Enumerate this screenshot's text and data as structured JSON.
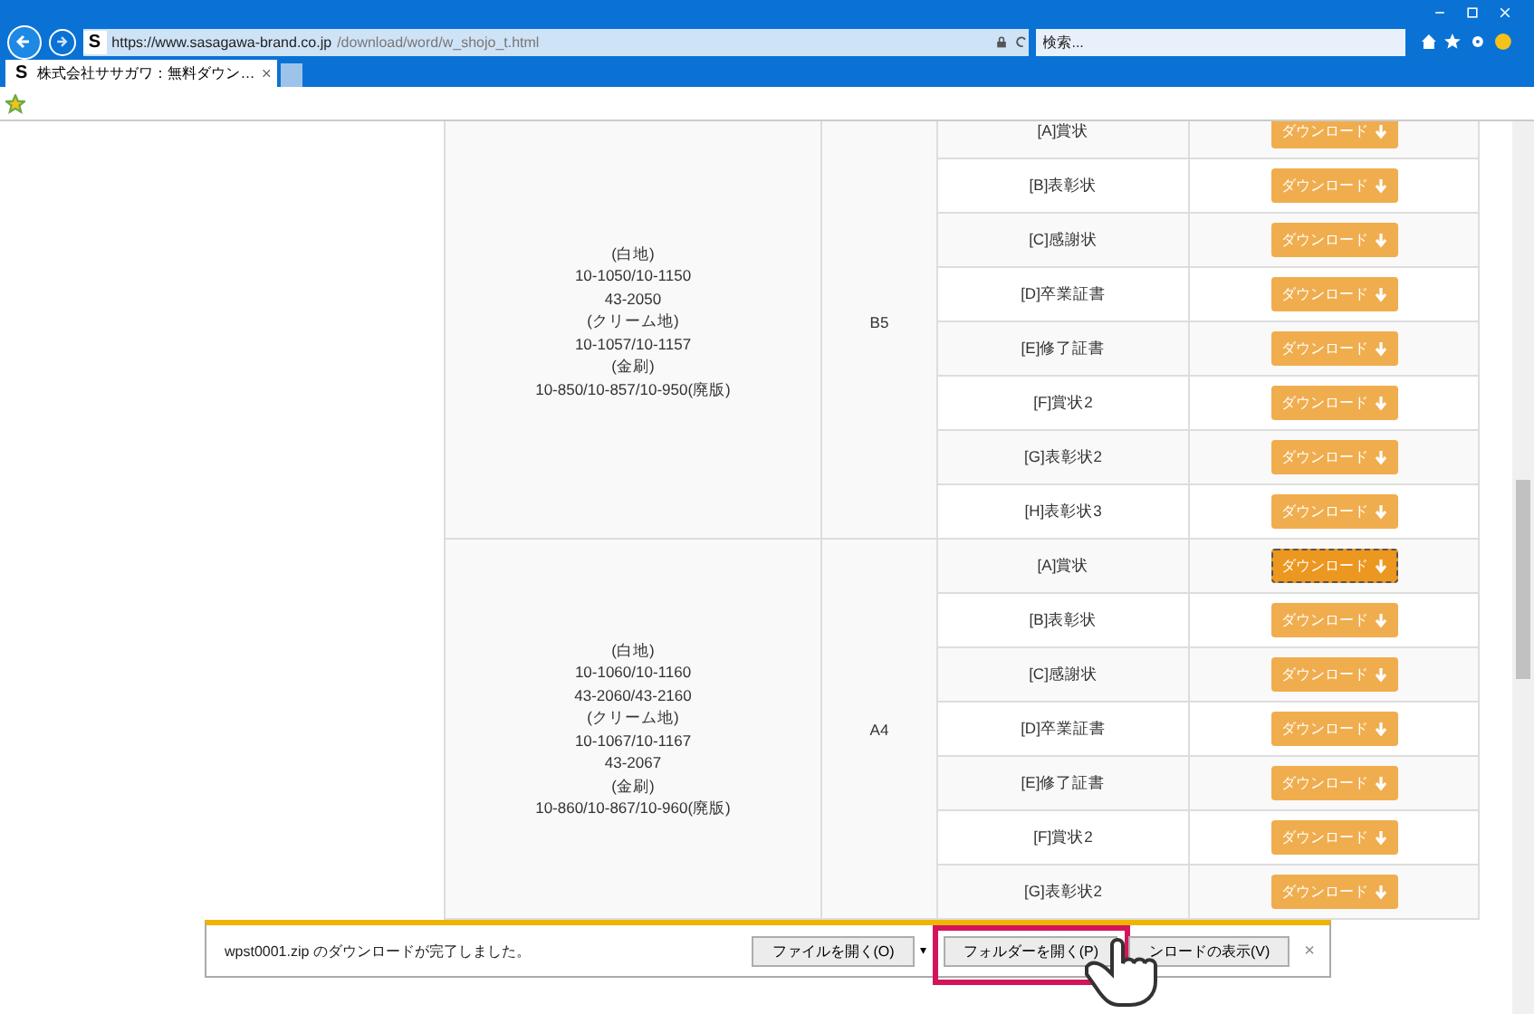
{
  "browser": {
    "address": {
      "site_icon": "S",
      "host": "https://www.sasagawa-brand.co.jp",
      "path": "/download/word/w_shojo_t.html"
    },
    "search": {
      "placeholder": "検索..."
    },
    "tabs": [
      {
        "icon": "S",
        "title": "株式会社ササガワ：無料ダウン…",
        "selected": true
      }
    ]
  },
  "table": {
    "groups": [
      {
        "products": [
          "(白地)",
          "10-1050/10-1150",
          "43-2050",
          "(クリーム地)",
          "10-1057/10-1157",
          "(金刷)",
          "10-850/10-857/10-950(廃版)"
        ],
        "size": "B5",
        "rows": [
          {
            "name": "[A]賞状",
            "button": "ダウンロード",
            "focused": false
          },
          {
            "name": "[B]表彰状",
            "button": "ダウンロード",
            "focused": false
          },
          {
            "name": "[C]感謝状",
            "button": "ダウンロード",
            "focused": false
          },
          {
            "name": "[D]卒業証書",
            "button": "ダウンロード",
            "focused": false
          },
          {
            "name": "[E]修了証書",
            "button": "ダウンロード",
            "focused": false
          },
          {
            "name": "[F]賞状2",
            "button": "ダウンロード",
            "focused": false
          },
          {
            "name": "[G]表彰状2",
            "button": "ダウンロード",
            "focused": false
          },
          {
            "name": "[H]表彰状3",
            "button": "ダウンロード",
            "focused": false
          }
        ]
      },
      {
        "products": [
          "(白地)",
          "10-1060/10-1160",
          "43-2060/43-2160",
          "(クリーム地)",
          "10-1067/10-1167",
          "43-2067",
          "(金刷)",
          "10-860/10-867/10-960(廃版)"
        ],
        "size": "A4",
        "rows": [
          {
            "name": "[A]賞状",
            "button": "ダウンロード",
            "focused": true
          },
          {
            "name": "[B]表彰状",
            "button": "ダウンロード",
            "focused": false
          },
          {
            "name": "[C]感謝状",
            "button": "ダウンロード",
            "focused": false
          },
          {
            "name": "[D]卒業証書",
            "button": "ダウンロード",
            "focused": false
          },
          {
            "name": "[E]修了証書",
            "button": "ダウンロード",
            "focused": false
          },
          {
            "name": "[F]賞状2",
            "button": "ダウンロード",
            "focused": false
          },
          {
            "name": "[G]表彰状2",
            "button": "ダウンロード",
            "focused": false
          }
        ]
      }
    ]
  },
  "download_bar": {
    "message": "wpst0001.zip のダウンロードが完了しました。",
    "buttons": [
      {
        "label": "ファイルを開く(O)",
        "kind": "split",
        "dropdown": "▾",
        "highlighted": false
      },
      {
        "label": "フォルダーを開く(P)",
        "kind": "plain",
        "highlighted": true
      },
      {
        "label": "ンロードの表示(V)",
        "kind": "plain",
        "highlighted": false
      }
    ],
    "close": "×"
  }
}
